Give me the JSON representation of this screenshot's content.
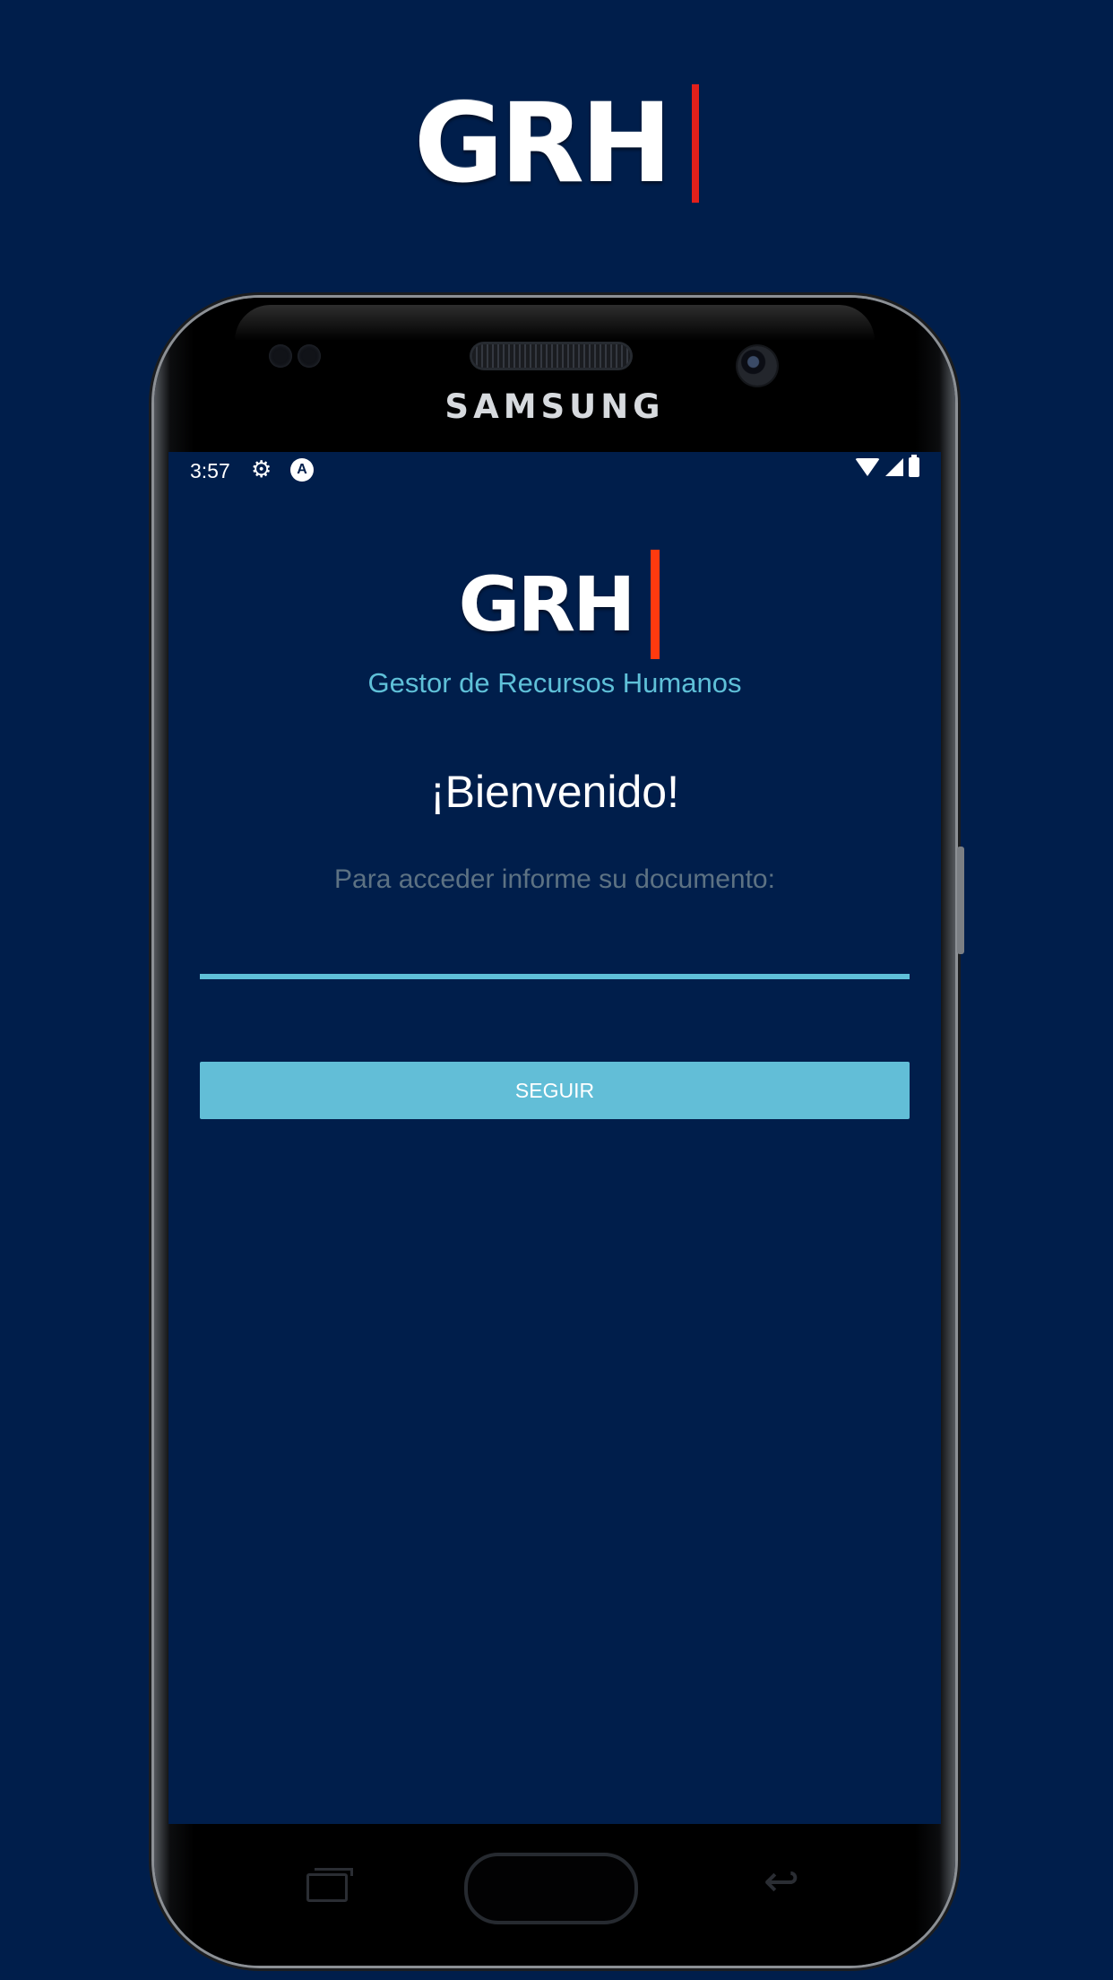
{
  "banner": {
    "logo_text": "GRH"
  },
  "phone": {
    "brand": "SAMSUNG"
  },
  "status_bar": {
    "time": "3:57",
    "settings_icon": "gear-icon",
    "notification_icon": "a-badge-icon",
    "wifi_icon": "wifi-icon",
    "signal_icon": "signal-icon",
    "battery_icon": "battery-icon"
  },
  "app": {
    "logo_text": "GRH",
    "subtitle": "Gestor de Recursos Humanos",
    "welcome": "¡Bienvenido!",
    "instruction": "Para acceder informe su documento:",
    "document_input_value": "",
    "button_label": "SEGUIR"
  },
  "colors": {
    "background": "#001e4b",
    "accent": "#62bed7",
    "logo_bar": "#e3201b",
    "subtitle": "#5fc0d8",
    "instruction": "#5d7283"
  }
}
